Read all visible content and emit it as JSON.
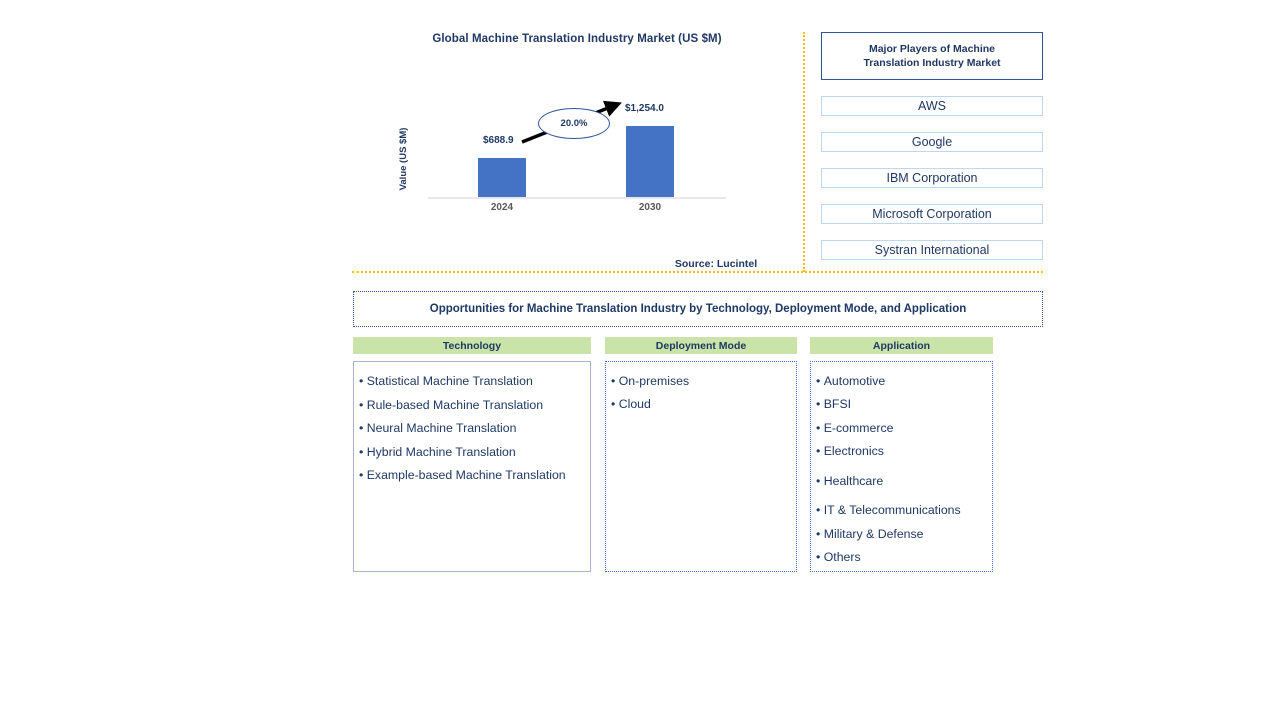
{
  "chart_title": "Global Machine Translation Industry Market (US $M)",
  "source_note": "Source: Lucintel",
  "chart_data": {
    "type": "bar",
    "title": "Global Machine Translation Industry Market (US $M)",
    "xlabel": "",
    "ylabel": "Value (US $M)",
    "categories": [
      "2024",
      "2030"
    ],
    "values": [
      688.9,
      1254.0
    ],
    "value_labels": [
      "$688.9",
      "$1,254.0"
    ],
    "annotation": "20.0%",
    "annotation_meaning": "CAGR arrow from 2024 bar to 2030 bar",
    "ylim": [
      0,
      1400
    ],
    "grid": false,
    "legend": "none",
    "bar_color": "#4472C4",
    "axis_color": "#E8E8E8"
  },
  "players": {
    "title": "Major Players of Machine Translation Industry Market",
    "title_line1": "Major Players of Machine",
    "title_line2": "Translation Industry Market",
    "items": [
      {
        "label": "AWS"
      },
      {
        "label": "Google"
      },
      {
        "label": "IBM Corporation"
      },
      {
        "label": "Microsoft Corporation"
      },
      {
        "label": "Systran International"
      }
    ]
  },
  "opportunities": {
    "banner": "Opportunities for Machine Translation Industry by Technology, Deployment Mode, and Application",
    "columns": [
      {
        "header": "Technology",
        "items": [
          "Statistical Machine Translation",
          "Rule-based Machine Translation",
          "Neural Machine Translation",
          "Hybrid Machine Translation",
          "Example-based Machine Translation"
        ]
      },
      {
        "header": "Deployment Mode",
        "items": [
          "On-premises",
          "Cloud"
        ]
      },
      {
        "header": "Application",
        "items": [
          "Automotive",
          "BFSI",
          "E-commerce",
          "Electronics",
          "Healthcare",
          "IT & Telecommunications",
          "Military & Defense",
          "Others"
        ]
      }
    ]
  },
  "colors": {
    "bar_blue": "#4472C4",
    "header_green": "#C9E3A8",
    "text_navy": "#1F3864",
    "divider_yellow": "#FFC000",
    "box_border_blue": "#BDD7EE"
  }
}
